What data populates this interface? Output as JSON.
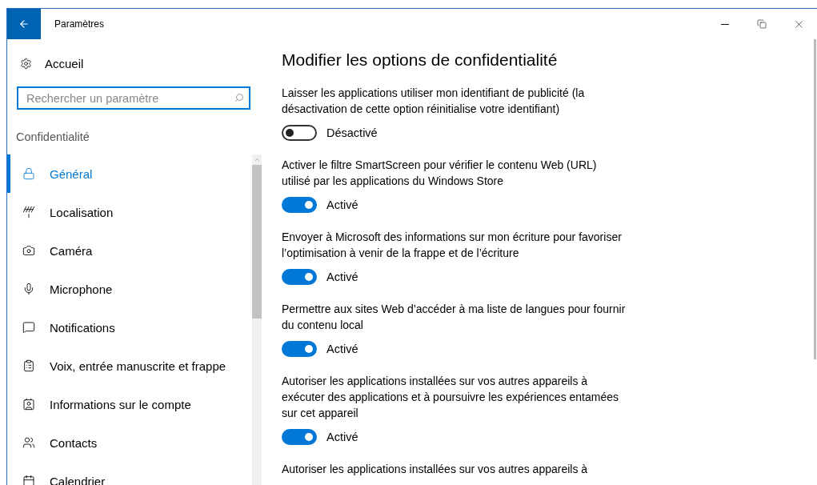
{
  "window": {
    "title": "Paramètres"
  },
  "sidebar": {
    "home": "Accueil",
    "search": {
      "placeholder": "Rechercher un paramètre"
    },
    "section": "Confidentialité",
    "items": [
      {
        "label": "Général",
        "selected": true
      },
      {
        "label": "Localisation",
        "selected": false
      },
      {
        "label": "Caméra",
        "selected": false
      },
      {
        "label": "Microphone",
        "selected": false
      },
      {
        "label": "Notifications",
        "selected": false
      },
      {
        "label": "Voix, entrée manuscrite et frappe",
        "selected": false
      },
      {
        "label": "Informations sur le compte",
        "selected": false
      },
      {
        "label": "Contacts",
        "selected": false
      },
      {
        "label": "Calendrier",
        "selected": false
      }
    ]
  },
  "main": {
    "heading": "Modifier les options de confidentialité",
    "settings": [
      {
        "description": "Laisser les applications utiliser mon identifiant de publicité (la désactivation de cette option réinitialise votre identifiant)",
        "on": false,
        "state_label": "Désactivé"
      },
      {
        "description": "Activer le filtre SmartScreen pour vérifier le contenu Web (URL) utilisé par les applications du Windows Store",
        "on": true,
        "state_label": "Activé"
      },
      {
        "description": "Envoyer à Microsoft des informations sur mon écriture pour favoriser l’optimisation à venir de la frappe et de l’écriture",
        "on": true,
        "state_label": "Activé"
      },
      {
        "description": "Permettre aux sites Web d’accéder à ma liste de langues pour fournir du contenu local",
        "on": true,
        "state_label": "Activé"
      },
      {
        "description": "Autoriser les applications installées sur vos autres appareils à exécuter des applications et à poursuivre les expériences entamées sur cet appareil",
        "on": true,
        "state_label": "Activé"
      },
      {
        "description": "Autoriser les applications installées sur vos autres appareils à"
      }
    ]
  }
}
